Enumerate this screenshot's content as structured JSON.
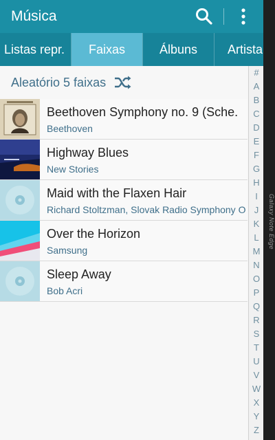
{
  "app": {
    "title": "Música",
    "search_icon": "search-icon",
    "more_icon": "more-vert-icon",
    "colors": {
      "topbar": "#1b8fa5",
      "tabs": "#178399",
      "active_tab": "#5bbad4",
      "accent_text": "#3f6f8a"
    }
  },
  "tabs": [
    {
      "label": "Listas repr.",
      "active": false
    },
    {
      "label": "Faixas",
      "active": true
    },
    {
      "label": "Álbuns",
      "active": false
    },
    {
      "label": "Artista",
      "active": false
    }
  ],
  "shuffle": {
    "label": "Aleatório 5 faixas",
    "icon": "shuffle-icon"
  },
  "tracks": [
    {
      "title": "Beethoven Symphony no. 9 (Sche.",
      "artist": "Beethoven"
    },
    {
      "title": "Highway Blues",
      "artist": "New Stories"
    },
    {
      "title": "Maid with the Flaxen Hair",
      "artist": "Richard Stoltzman, Slovak Radio Symphony O."
    },
    {
      "title": "Over the Horizon",
      "artist": "Samsung"
    },
    {
      "title": "Sleep Away",
      "artist": "Bob Acri"
    }
  ],
  "index_letters": [
    "#",
    "A",
    "B",
    "C",
    "D",
    "E",
    "F",
    "G",
    "H",
    "I",
    "J",
    "K",
    "L",
    "M",
    "N",
    "O",
    "P",
    "Q",
    "R",
    "S",
    "T",
    "U",
    "V",
    "W",
    "X",
    "Y",
    "Z"
  ],
  "edge_label": "Galaxy Note Edge"
}
